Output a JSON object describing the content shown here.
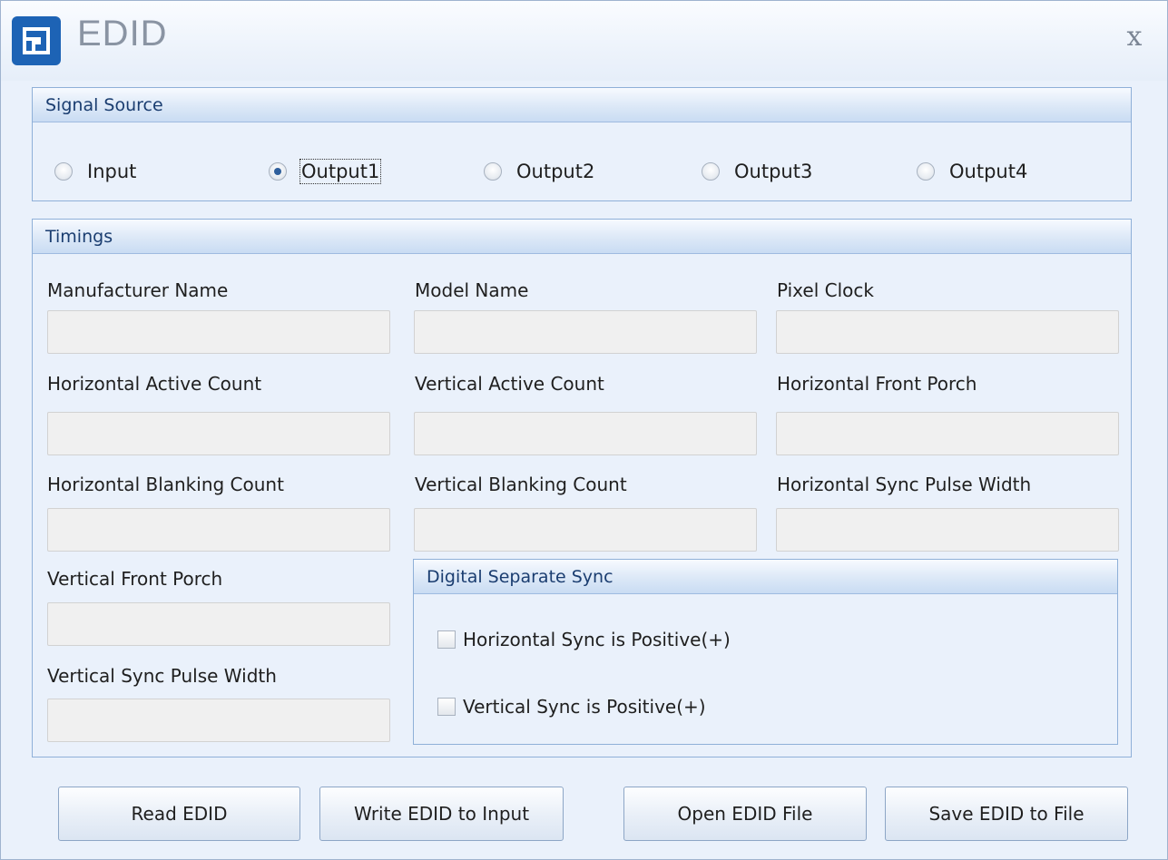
{
  "window": {
    "title": "EDID",
    "close_glyph": "x",
    "app_icon": "app-logo-icon"
  },
  "signal_source": {
    "header": "Signal Source",
    "options": [
      "Input",
      "Output1",
      "Output2",
      "Output3",
      "Output4"
    ],
    "selected": "Output1"
  },
  "timings": {
    "header": "Timings",
    "fields": {
      "manufacturer_name": {
        "label": "Manufacturer Name",
        "value": ""
      },
      "model_name": {
        "label": "Model Name",
        "value": ""
      },
      "pixel_clock": {
        "label": "Pixel Clock",
        "value": ""
      },
      "horizontal_active_count": {
        "label": "Horizontal Active Count",
        "value": ""
      },
      "vertical_active_count": {
        "label": "Vertical Active Count",
        "value": ""
      },
      "horizontal_front_porch": {
        "label": "Horizontal Front Porch",
        "value": ""
      },
      "horizontal_blanking_count": {
        "label": "Horizontal Blanking Count",
        "value": ""
      },
      "vertical_blanking_count": {
        "label": "Vertical Blanking Count",
        "value": ""
      },
      "horizontal_sync_pulse_width": {
        "label": "Horizontal Sync Pulse Width",
        "value": ""
      },
      "vertical_front_porch": {
        "label": "Vertical Front Porch",
        "value": ""
      },
      "vertical_sync_pulse_width": {
        "label": "Vertical Sync Pulse Width",
        "value": ""
      }
    }
  },
  "digital_separate_sync": {
    "header": "Digital Separate Sync",
    "horizontal_positive_label": "Horizontal Sync is Positive(+)",
    "horizontal_positive_checked": false,
    "vertical_positive_label": "Vertical Sync is Positive(+)",
    "vertical_positive_checked": false
  },
  "buttons": {
    "read": "Read EDID",
    "write_input": "Write EDID to Input",
    "open_file": "Open EDID File",
    "save_file": "Save EDID to File"
  },
  "colors": {
    "window_bg": "#eaf1fb",
    "group_border": "#8fb0d8",
    "header_text": "#1a3d70",
    "app_icon_bg": "#1d63b5"
  }
}
